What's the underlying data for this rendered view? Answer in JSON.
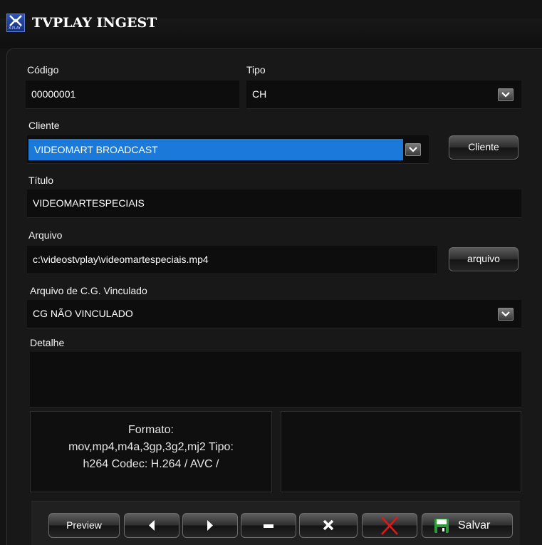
{
  "window": {
    "title": "TVPLAY INGEST",
    "logo_text": "X-PLAY"
  },
  "form": {
    "codigo": {
      "label": "Código",
      "value": "00000001"
    },
    "tipo": {
      "label": "Tipo",
      "value": "CH"
    },
    "cliente": {
      "label": "Cliente",
      "value": "VIDEOMART BROADCAST",
      "button": "Cliente"
    },
    "titulo": {
      "label": "Título",
      "value": "VIDEOMARTESPECIAIS"
    },
    "arquivo": {
      "label": "Arquivo",
      "value": "c:\\videostvplay\\videomartespeciais.mp4",
      "button": "arquivo"
    },
    "cg": {
      "label": "Arquivo de C.G. Vinculado",
      "value": "CG NÃO VINCULADO"
    },
    "detalhe": {
      "label": "Detalhe",
      "value": ""
    }
  },
  "info": {
    "line1": "Formato:",
    "line2": "mov,mp4,m4a,3gp,3g2,mj2 Tipo:",
    "line3": "h264 Codec: H.264 / AVC /"
  },
  "toolbar": {
    "preview": "Preview",
    "save": "Salvar",
    "icons": [
      "arrow-left-icon",
      "arrow-right-icon",
      "minus-icon",
      "close-icon",
      "delete-red-x-icon",
      "save-disk-icon"
    ]
  },
  "colors": {
    "selection": "#1b79d9",
    "background": "#141414",
    "delete_red": "#e01818",
    "save_green": "#2e9a3a"
  }
}
